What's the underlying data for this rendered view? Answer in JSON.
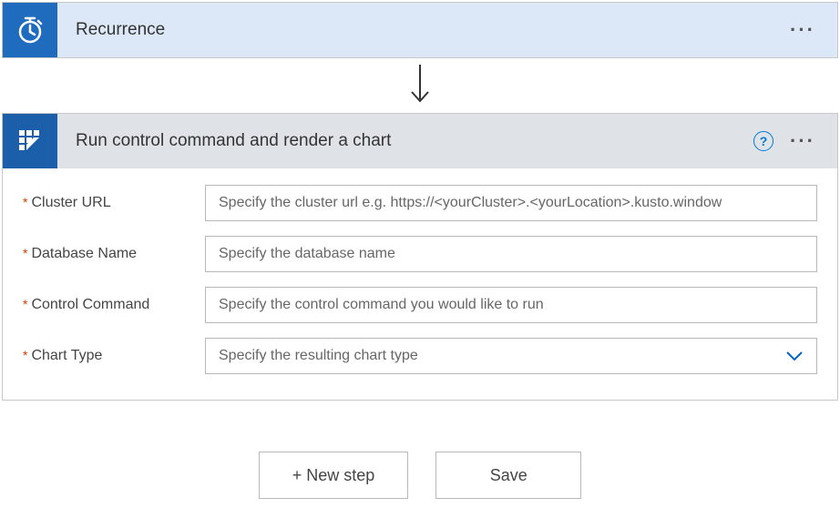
{
  "recurrence": {
    "title": "Recurrence"
  },
  "action": {
    "title": "Run control command and render a chart",
    "help": "?",
    "fields": {
      "cluster_url": {
        "label": "Cluster URL",
        "placeholder": "Specify the cluster url e.g. https://<yourCluster>.<yourLocation>.kusto.window"
      },
      "database_name": {
        "label": "Database Name",
        "placeholder": "Specify the database name"
      },
      "control_command": {
        "label": "Control Command",
        "placeholder": "Specify the control command you would like to run"
      },
      "chart_type": {
        "label": "Chart Type",
        "placeholder": "Specify the resulting chart type"
      }
    }
  },
  "footer": {
    "new_step": "+ New step",
    "save": "Save"
  },
  "ellipsis": "···"
}
